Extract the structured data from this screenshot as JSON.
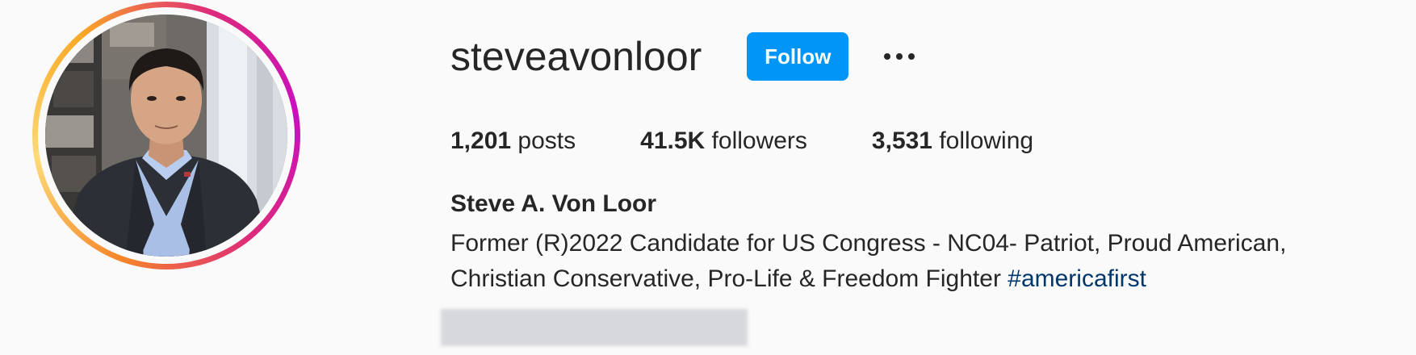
{
  "profile": {
    "username": "steveavonloor",
    "follow_label": "Follow",
    "more_icon": "more-horizontal-icon",
    "stats": {
      "posts_count": "1,201",
      "posts_label": "posts",
      "followers_count": "41.5K",
      "followers_label": "followers",
      "following_count": "3,531",
      "following_label": "following"
    },
    "full_name": "Steve A. Von Loor",
    "bio_line1": "Former (R)2022 Candidate for US Congress - NC04- Patriot, Proud American,",
    "bio_line2": "Christian Conservative, Pro-Life & Freedom Fighter ",
    "bio_hashtag": "#americafirst"
  },
  "colors": {
    "follow_button": "#0095f6",
    "hashtag": "#00376b",
    "background": "#fafafa",
    "text": "#262626"
  }
}
